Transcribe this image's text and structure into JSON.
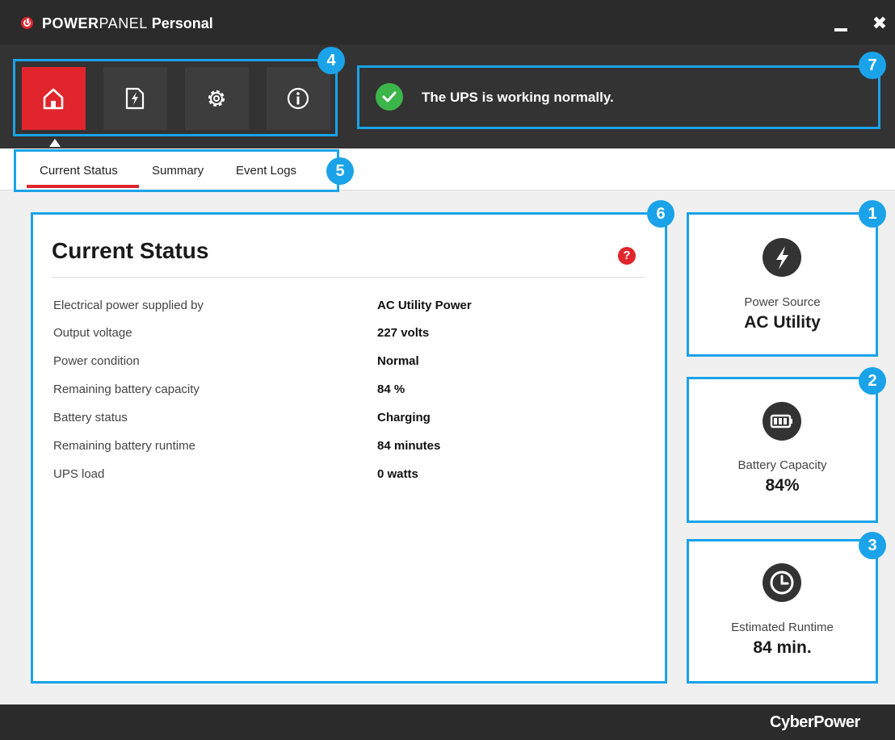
{
  "app": {
    "title_part1": "POWER",
    "title_part2": "PANEL",
    "title_part3": " Personal",
    "close_glyph": "✖"
  },
  "nav": {
    "items": [
      {
        "icon": "home-icon",
        "active": true
      },
      {
        "icon": "power-icon",
        "active": false
      },
      {
        "icon": "settings-icon",
        "active": false
      },
      {
        "icon": "info-icon",
        "active": false
      }
    ]
  },
  "status": {
    "message": "The UPS is working normally.",
    "color": "#3cb54a"
  },
  "tabs": {
    "current_status": "Current Status",
    "summary": "Summary",
    "event_logs": "Event Logs"
  },
  "main": {
    "title": "Current Status",
    "help_glyph": "?",
    "rows": [
      {
        "label": "Electrical power supplied by",
        "value": "AC Utility Power"
      },
      {
        "label": "Output voltage",
        "value": "227 volts"
      },
      {
        "label": "Power condition",
        "value": "Normal"
      },
      {
        "label": "Remaining battery capacity",
        "value": "84 %"
      },
      {
        "label": "Battery status",
        "value": "Charging"
      },
      {
        "label": "Remaining battery runtime",
        "value": "84 minutes"
      },
      {
        "label": "UPS load",
        "value": "0 watts"
      }
    ]
  },
  "cards": {
    "power_source": {
      "label": "Power Source",
      "value": "AC Utility",
      "icon": "lightning-icon"
    },
    "battery": {
      "label": "Battery Capacity",
      "value": "84%",
      "icon": "battery-icon"
    },
    "runtime": {
      "label": "Estimated Runtime",
      "value": "84 min.",
      "icon": "clock-icon"
    }
  },
  "callouts": {
    "n1": "1",
    "n2": "2",
    "n3": "3",
    "n4": "4",
    "n5": "5",
    "n6": "6",
    "n7": "7"
  },
  "colors": {
    "accent": "#e0252d",
    "callout": "#1aa3e8"
  },
  "footer": {
    "brand_a": "Cyber",
    "brand_b": "Power"
  }
}
